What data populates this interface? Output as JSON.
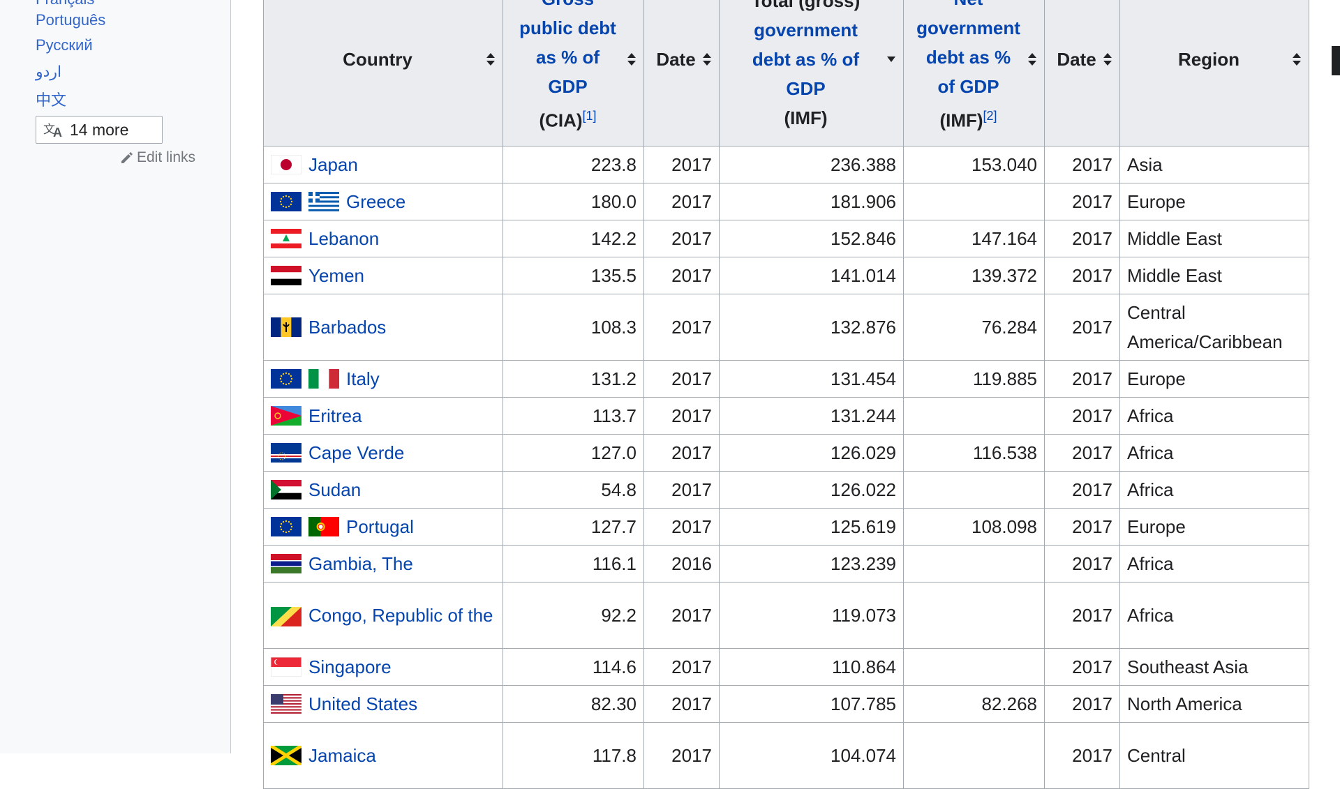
{
  "sidebar": {
    "languages": [
      "Français",
      "Português",
      "Русский",
      "اردو",
      "中文"
    ],
    "more_button": "14 more",
    "edit_links": "Edit links"
  },
  "table": {
    "headers": [
      {
        "lines": [
          "Country"
        ],
        "link": false,
        "sup": ""
      },
      {
        "lines": [
          "Gross",
          "public debt",
          "as % of",
          "GDP"
        ],
        "tail": "(CIA)",
        "link": true,
        "sup": "[1]"
      },
      {
        "lines": [
          "Date"
        ],
        "link": false,
        "sup": ""
      },
      {
        "lines": [
          "Total (gross)"
        ],
        "link_lines": [
          "government",
          "debt as % of",
          "GDP"
        ],
        "tail": "(IMF)",
        "sup": ""
      },
      {
        "lines": [
          "Net",
          "government",
          "debt as %",
          "of GDP"
        ],
        "tail": "(IMF)",
        "link": true,
        "sup": "[2]"
      },
      {
        "lines": [
          "Date"
        ],
        "link": false,
        "sup": ""
      },
      {
        "lines": [
          "Region"
        ],
        "link": false,
        "sup": ""
      }
    ],
    "rows": [
      {
        "country": "Japan",
        "cia": "223.8",
        "date1": "2017",
        "imf_total": "236.388",
        "imf_net": "153.040",
        "date2": "2017",
        "region": "Asia",
        "flags": [
          "japan"
        ]
      },
      {
        "country": "Greece",
        "cia": "180.0",
        "date1": "2017",
        "imf_total": "181.906",
        "imf_net": "",
        "date2": "2017",
        "region": "Europe",
        "flags": [
          "eu",
          "greece"
        ]
      },
      {
        "country": "Lebanon",
        "cia": "142.2",
        "date1": "2017",
        "imf_total": "152.846",
        "imf_net": "147.164",
        "date2": "2017",
        "region": "Middle East",
        "flags": [
          "lebanon"
        ]
      },
      {
        "country": "Yemen",
        "cia": "135.5",
        "date1": "2017",
        "imf_total": "141.014",
        "imf_net": "139.372",
        "date2": "2017",
        "region": "Middle East",
        "flags": [
          "yemen"
        ]
      },
      {
        "country": "Barbados",
        "cia": "108.3",
        "date1": "2017",
        "imf_total": "132.876",
        "imf_net": "76.284",
        "date2": "2017",
        "region": "Central America/Caribbean",
        "flags": [
          "barbados"
        ]
      },
      {
        "country": "Italy",
        "cia": "131.2",
        "date1": "2017",
        "imf_total": "131.454",
        "imf_net": "119.885",
        "date2": "2017",
        "region": "Europe",
        "flags": [
          "eu",
          "italy"
        ]
      },
      {
        "country": "Eritrea",
        "cia": "113.7",
        "date1": "2017",
        "imf_total": "131.244",
        "imf_net": "",
        "date2": "2017",
        "region": "Africa",
        "flags": [
          "eritrea"
        ]
      },
      {
        "country": "Cape Verde",
        "cia": "127.0",
        "date1": "2017",
        "imf_total": "126.029",
        "imf_net": "116.538",
        "date2": "2017",
        "region": "Africa",
        "flags": [
          "capeverde"
        ]
      },
      {
        "country": "Sudan",
        "cia": "54.8",
        "date1": "2017",
        "imf_total": "126.022",
        "imf_net": "",
        "date2": "2017",
        "region": "Africa",
        "flags": [
          "sudan"
        ]
      },
      {
        "country": "Portugal",
        "cia": "127.7",
        "date1": "2017",
        "imf_total": "125.619",
        "imf_net": "108.098",
        "date2": "2017",
        "region": "Europe",
        "flags": [
          "eu",
          "portugal"
        ]
      },
      {
        "country": "Gambia, The",
        "cia": "116.1",
        "date1": "2016",
        "imf_total": "123.239",
        "imf_net": "",
        "date2": "2017",
        "region": "Africa",
        "flags": [
          "gambia"
        ]
      },
      {
        "country": "Congo, Republic of the",
        "cia": "92.2",
        "date1": "2017",
        "imf_total": "119.073",
        "imf_net": "",
        "date2": "2017",
        "region": "Africa",
        "flags": [
          "congo"
        ]
      },
      {
        "country": "Singapore",
        "cia": "114.6",
        "date1": "2017",
        "imf_total": "110.864",
        "imf_net": "",
        "date2": "2017",
        "region": "Southeast Asia",
        "flags": [
          "singapore"
        ]
      },
      {
        "country": "United States",
        "cia": "82.30",
        "date1": "2017",
        "imf_total": "107.785",
        "imf_net": "82.268",
        "date2": "2017",
        "region": "North America",
        "flags": [
          "usa"
        ]
      },
      {
        "country": "Jamaica",
        "cia": "117.8",
        "date1": "2017",
        "imf_total": "104.074",
        "imf_net": "",
        "date2": "2017",
        "region": "Central",
        "flags": [
          "jamaica"
        ]
      }
    ]
  },
  "colors": {
    "link": "#0645ad",
    "header_bg": "#eaecf0",
    "border": "#a2a9b1",
    "sidebar_bg": "#f8f9fa"
  }
}
